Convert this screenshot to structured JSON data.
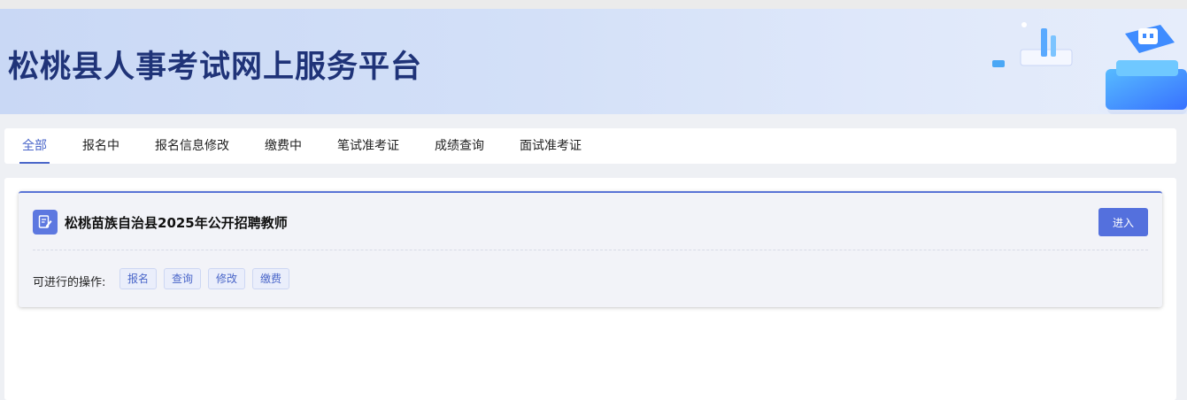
{
  "banner": {
    "title": "松桃县人事考试网上服务平台"
  },
  "tabs": [
    {
      "label": "全部",
      "active": true
    },
    {
      "label": "报名中"
    },
    {
      "label": "报名信息修改"
    },
    {
      "label": "缴费中"
    },
    {
      "label": "笔试准考证"
    },
    {
      "label": "成绩查询"
    },
    {
      "label": "面试准考证"
    }
  ],
  "exam_card": {
    "icon": "edit-document-icon",
    "title": "松桃苗族自治县2025年公开招聘教师",
    "enter_label": "进入",
    "operations_label": "可进行的操作:",
    "operations": [
      "报名",
      "查询",
      "修改",
      "缴费"
    ]
  },
  "colors": {
    "accent": "#4a66c9",
    "banner_title": "#1f3378",
    "button": "#5470dd"
  }
}
